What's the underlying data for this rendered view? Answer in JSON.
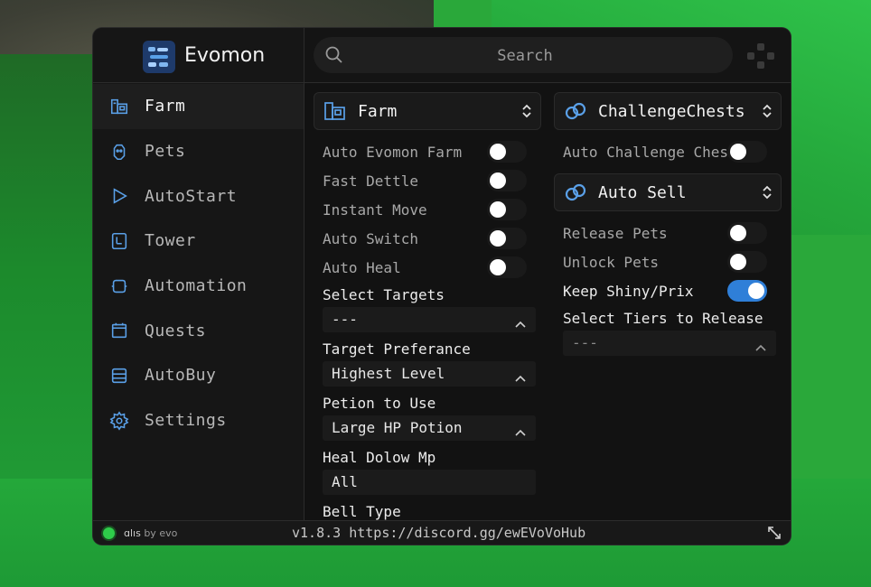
{
  "app": {
    "name": "Evomon",
    "accent": "#2f7fd8",
    "icon_accent": "#5aa0e8"
  },
  "search": {
    "placeholder": "Search"
  },
  "sidebar": {
    "items": [
      {
        "label": "Farm",
        "icon": "farm-icon",
        "active": true
      },
      {
        "label": "Pets",
        "icon": "pets-icon"
      },
      {
        "label": "AutoStart",
        "icon": "play-icon"
      },
      {
        "label": "Tower",
        "icon": "tower-icon"
      },
      {
        "label": "Automation",
        "icon": "automation-icon"
      },
      {
        "label": "Quests",
        "icon": "calendar-icon"
      },
      {
        "label": "AutoBuy",
        "icon": "shop-icon"
      },
      {
        "label": "Settings",
        "icon": "gear-icon"
      }
    ]
  },
  "farm": {
    "title": "Farm",
    "toggles": [
      {
        "label": "Auto Evomon Farm",
        "on": false
      },
      {
        "label": "Fast Dettle",
        "on": false
      },
      {
        "label": "Instant Move",
        "on": false
      },
      {
        "label": "Auto Switch",
        "on": false
      },
      {
        "label": "Auto Heal",
        "on": false
      }
    ],
    "select_targets": {
      "label": "Select Targets",
      "value": "---"
    },
    "target_preference": {
      "label": "Target Preferance",
      "value": "Highest Level"
    },
    "potion": {
      "label": "Petion to Use",
      "value": "Large HP Potion"
    },
    "heal_below": {
      "label": "Heal Dolow Mp",
      "value": "All"
    },
    "bell_type": {
      "label": "Bell Type"
    }
  },
  "challenge": {
    "title": "ChallengeChests",
    "toggles": [
      {
        "label": "Auto Challenge Chest",
        "on": false
      }
    ]
  },
  "autosell": {
    "title": "Auto Sell",
    "toggles": [
      {
        "label": "Release Pets",
        "on": false
      },
      {
        "label": "Unlock Pets",
        "on": false
      },
      {
        "label": "Keep Shiny/Prix",
        "on": true
      }
    ],
    "tiers": {
      "label": "Select Tiers to Release",
      "value": "---"
    }
  },
  "footer": {
    "brand": "ɑlıs",
    "by": "by evo",
    "version": "v1.8.3 https://discord.gg/ewEVoVoHub"
  }
}
